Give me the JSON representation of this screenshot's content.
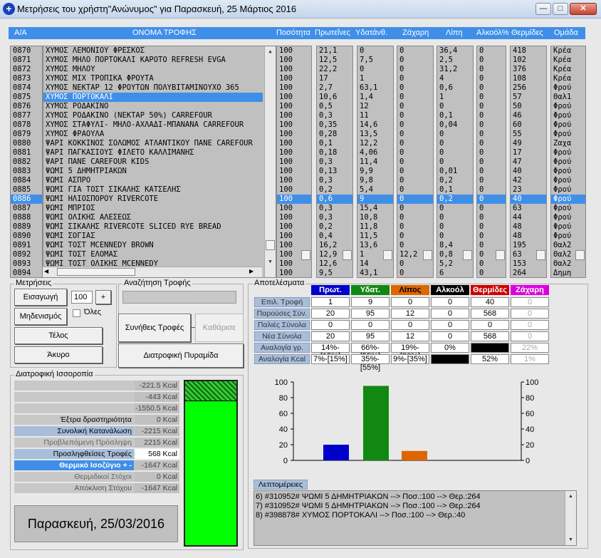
{
  "window": {
    "title": "Μετρήσεις του χρήστη\"Ανώνυμος\" για Παρασκευή, 25 Μάρτιος 2016",
    "minimize": "—",
    "maximize": "□",
    "close": "✕"
  },
  "colors": {
    "selection": "#3f8fe8",
    "protein": "#0000cc",
    "water": "#118811",
    "fat": "#dd6600",
    "alcohol": "#000000",
    "calories": "#cc0000",
    "sugar": "#dd00dd",
    "gauge": "#00ff00"
  },
  "headers": {
    "aa": "Α/Α",
    "name": "ΟΝΟΜΑ ΤΡΟΦΗΣ",
    "qty": "Ποσότητα",
    "protein": "Πρωτεΐνες",
    "water": "Υδατάνθ.",
    "sugar": "Ζάχαρη",
    "fat": "Λίπη",
    "alcohol": "Αλκοόλ%",
    "calories": "Θερμίδες",
    "group": "Ομάδα"
  },
  "rows": [
    {
      "aa": "0870",
      "name": "ΧΥΜΟΣ ΛΕΜΟΝΙΟΥ ΦΡΕΣΚΟΣ",
      "qty": "100",
      "protein": "21,1",
      "water": "0",
      "sugar": "0",
      "fat": "36,4",
      "alcohol": "0",
      "cal": "418",
      "group": "Κρέα"
    },
    {
      "aa": "0871",
      "name": "ΧΥΜΟΣ ΜΗΛΟ ΠΟΡΤΟΚΑΛΙ ΚΑΡΟΤΟ REFRESH EVGA",
      "qty": "100",
      "protein": "12,5",
      "water": "7,5",
      "sugar": "0",
      "fat": "2,5",
      "alcohol": "0",
      "cal": "102",
      "group": "Κρέα"
    },
    {
      "aa": "0872",
      "name": "ΧΥΜΟΣ ΜΗΛΟΥ",
      "qty": "100",
      "protein": "22,2",
      "water": "0",
      "sugar": "0",
      "fat": "31,2",
      "alcohol": "0",
      "cal": "376",
      "group": "Κρέα"
    },
    {
      "aa": "0873",
      "name": "ΧΥΜΟΣ ΜΙΧ ΤΡΟΠΙΚΑ ΦΡΟΥΤΑ",
      "qty": "100",
      "protein": "17",
      "water": "1",
      "sugar": "0",
      "fat": "4",
      "alcohol": "0",
      "cal": "108",
      "group": "Κρέα"
    },
    {
      "aa": "0874",
      "name": "ΧΥΜΟΣ ΝΕΚΤΑΡ 12 ΦΡΟΥΤΩΝ ΠΟΛΥΒΙΤΑΜΙΝΟΥΧΟ 365",
      "qty": "100",
      "protein": "2,7",
      "water": "63,1",
      "sugar": "0",
      "fat": "0,6",
      "alcohol": "0",
      "cal": "256",
      "group": "Φρού"
    },
    {
      "aa": "0875",
      "name": "ΧΥΜΟΣ ΠΟΡΤΟΚΑΛΙ",
      "qty": "100",
      "protein": "10,6",
      "water": "1,4",
      "sugar": "0",
      "fat": "1",
      "alcohol": "0",
      "cal": "57",
      "group": "Θαλ1",
      "nameSel": true
    },
    {
      "aa": "0876",
      "name": "ΧΥΜΟΣ ΡΟΔΑΚΙΝΟ",
      "qty": "100",
      "protein": "0,5",
      "water": "12",
      "sugar": "0",
      "fat": "0",
      "alcohol": "0",
      "cal": "50",
      "group": "Φρού"
    },
    {
      "aa": "0877",
      "name": "ΧΥΜΟΣ ΡΟΔΑΚΙΝΟ (ΝΕΚΤΑΡ 50%) CARREFOUR",
      "qty": "100",
      "protein": "0,3",
      "water": "11",
      "sugar": "0",
      "fat": "0,1",
      "alcohol": "0",
      "cal": "46",
      "group": "Φρού"
    },
    {
      "aa": "0878",
      "name": "ΧΥΜΟΣ ΣΤΑΦΥΛΙ- ΜΗΛΟ-ΑΧΛΑΔΙ-ΜΠΑΝΑΝΑ CARREFOUR",
      "qty": "100",
      "protein": "0,35",
      "water": "14,6",
      "sugar": "0",
      "fat": "0,04",
      "alcohol": "0",
      "cal": "60",
      "group": "Φρού"
    },
    {
      "aa": "0879",
      "name": "ΧΥΜΟΣ ΦΡΑΟΥΛΑ",
      "qty": "100",
      "protein": "0,28",
      "water": "13,5",
      "sugar": "0",
      "fat": "0",
      "alcohol": "0",
      "cal": "55",
      "group": "Φρού"
    },
    {
      "aa": "0880",
      "name": "ΨΑΡΙ ΚΟΚΚΙΝΟΣ ΣΟΛΩΜΟΣ ΑΤΛΑΝΤΙΚΟΥ ΠΑΝΕ CAREFOUR",
      "qty": "100",
      "protein": "0,1",
      "water": "12,2",
      "sugar": "0",
      "fat": "0",
      "alcohol": "0",
      "cal": "49",
      "group": "Ζαχα"
    },
    {
      "aa": "0881",
      "name": "ΨΑΡΙ ΠΑΓΚΑΣΙΟΥΣ ΦΙΛΕΤΟ ΚΑΛΛΙΜΑΝΗΣ",
      "qty": "100",
      "protein": "0,18",
      "water": "4,06",
      "sugar": "0",
      "fat": "0",
      "alcohol": "0",
      "cal": "17",
      "group": "Φρού"
    },
    {
      "aa": "0882",
      "name": "ΨΑΡΙ ΠΑΝΕ CAREFOUR KIDS",
      "qty": "100",
      "protein": "0,3",
      "water": "11,4",
      "sugar": "0",
      "fat": "0",
      "alcohol": "0",
      "cal": "47",
      "group": "Φρού"
    },
    {
      "aa": "0883",
      "name": "ΨΩΜΙ 5 ΔΗΜΗΤΡΙΑΚΩΝ",
      "qty": "100",
      "protein": "0,13",
      "water": "9,9",
      "sugar": "0",
      "fat": "0,01",
      "alcohol": "0",
      "cal": "40",
      "group": "Φρού"
    },
    {
      "aa": "0884",
      "name": "ΨΩΜΙ ΑΣΠΡΟ",
      "qty": "100",
      "protein": "0,3",
      "water": "9,8",
      "sugar": "0",
      "fat": "0,2",
      "alcohol": "0",
      "cal": "42",
      "group": "Φρού"
    },
    {
      "aa": "0885",
      "name": "ΨΩΜΙ ΓΙΑ ΤΟΣΤ ΣΙΚΑΛΗΣ ΚΑΤΣΕΛΗΣ",
      "qty": "100",
      "protein": "0,2",
      "water": "5,4",
      "sugar": "0",
      "fat": "0,1",
      "alcohol": "0",
      "cal": "23",
      "group": "Φρού"
    },
    {
      "aa": "0886",
      "name": "ΨΩΜΙ ΗΛΙΟΣΠΟΡΟΥ RIVERCOTE",
      "qty": "100",
      "protein": "0,6",
      "water": "9",
      "sugar": "0",
      "fat": "0,2",
      "alcohol": "0",
      "cal": "40",
      "group": "Φρού",
      "rowSel": true
    },
    {
      "aa": "0887",
      "name": "ΨΩΜΙ ΜΠΡΙΟΣ",
      "qty": "100",
      "protein": "0,3",
      "water": "15,4",
      "sugar": "0",
      "fat": "0",
      "alcohol": "0",
      "cal": "63",
      "group": "Φρού"
    },
    {
      "aa": "0888",
      "name": "ΨΩΜΙ ΟΛΙΚΗΣ ΑΛΕΣΕΩΣ",
      "qty": "100",
      "protein": "0,3",
      "water": "10,8",
      "sugar": "0",
      "fat": "0",
      "alcohol": "0",
      "cal": "44",
      "group": "Φρού"
    },
    {
      "aa": "0889",
      "name": "ΨΩΜΙ ΣΙΚΑΛΗΣ RIVERCOTE SLICED RYE BREAD",
      "qty": "100",
      "protein": "0,2",
      "water": "11,8",
      "sugar": "0",
      "fat": "0",
      "alcohol": "0",
      "cal": "48",
      "group": "Φρού"
    },
    {
      "aa": "0890",
      "name": "ΨΩΜΙ ΣΟΓΙΑΣ",
      "qty": "100",
      "protein": "0,4",
      "water": "11,5",
      "sugar": "0",
      "fat": "0",
      "alcohol": "0",
      "cal": "48",
      "group": "Φρού"
    },
    {
      "aa": "0891",
      "name": "ΨΩΜΙ ΤΟΣΤ MCENNEDY BROWN",
      "qty": "100",
      "protein": "16,2",
      "water": "13,6",
      "sugar": "0",
      "fat": "8,4",
      "alcohol": "0",
      "cal": "195",
      "group": "Θαλ2"
    },
    {
      "aa": "0892",
      "name": "ΨΩΜΙ ΤΟΣΤ ΕΛΟΜΑΣ",
      "qty": "100",
      "protein": "12,9",
      "water": "1",
      "sugar": "12,2",
      "fat": "0,8",
      "alcohol": "0",
      "cal": "63",
      "group": "Θαλ2"
    },
    {
      "aa": "0893",
      "name": "ΨΩΜΙ ΤΟΣΤ ΟΛΙΚΗΣ MCENNEDY",
      "qty": "100",
      "protein": "12,6",
      "water": "14",
      "sugar": "0",
      "fat": "5,2",
      "alcohol": "0",
      "cal": "153",
      "group": "Θαλ2"
    },
    {
      "aa": "0894",
      "name": "",
      "qty": "100",
      "protein": "9,5",
      "water": "43,1",
      "sugar": "0",
      "fat": "6",
      "alcohol": "0",
      "cal": "264",
      "group": "Δημη"
    }
  ],
  "measurements": {
    "title": "Μετρήσεις",
    "insert": "Εισαγωγή",
    "reset": "Μηδενισμός",
    "all": "Όλες",
    "qty": "100",
    "plus": "+",
    "end": "Τέλος",
    "cancel": "Άκυρο"
  },
  "search": {
    "title": "Αναζήτηση Τροφής",
    "value": "",
    "usual": "Συνήθεις Τροφές",
    "clear": "Καθάρισε",
    "pyramid": "Διατροφική Πυραμίδα"
  },
  "results": {
    "title": "Αποτελέσματα",
    "cols": [
      "Πρωτ.",
      "Υδατ.",
      "Λίπος",
      "Αλκοόλ",
      "Θερμίδες",
      "Ζάχαρη"
    ],
    "rows": [
      {
        "label": "Επιλ. Τροφή",
        "values": [
          "1",
          "9",
          "0",
          "0",
          "40",
          "0"
        ]
      },
      {
        "label": "Παρούσες Σύν.",
        "values": [
          "20",
          "95",
          "12",
          "0",
          "568",
          "0"
        ]
      },
      {
        "label": "Παλιές Σύνολα",
        "values": [
          "0",
          "0",
          "0",
          "0",
          "0",
          "0"
        ]
      },
      {
        "label": "Νέα Σύνολα",
        "values": [
          "20",
          "95",
          "12",
          "0",
          "568",
          "0"
        ]
      },
      {
        "label": "Αναλογία γρ.",
        "values": [
          "14%-[15%]",
          "66%-[55%]",
          "19%-[30%]",
          "0%",
          "",
          "22%"
        ]
      },
      {
        "label": "Αναλογία Kcal",
        "values": [
          "7%-[15%]",
          "35%-[55%]",
          "9%-[35%]",
          "",
          "52%",
          "1%"
        ]
      }
    ]
  },
  "balance": {
    "title": "Διατροφική Ισσοροπία",
    "rows": [
      {
        "label": "",
        "value": "-221.5 Kcal"
      },
      {
        "label": "",
        "value": "-443 Kcal"
      },
      {
        "label": "",
        "value": "-1550.5 Kcal"
      },
      {
        "label": "Έξτρα δραστηριότητα",
        "value": "0 Kcal"
      },
      {
        "label": "Συνολική Κατανάλωση",
        "value": "-2215 Kcal"
      },
      {
        "label": "Προβλεπόμενη Πρόσληψη",
        "value": "2215 Kcal"
      },
      {
        "label": "Προσληφθείσες Τροφές",
        "value": "568 Kcal"
      },
      {
        "label": "Θερμικό Ισοζύγιο + -",
        "value": "-1647 Kcal"
      },
      {
        "label": "Θερμιδικοί Στόχοι",
        "value": "0 Kcal"
      },
      {
        "label": "Απόκλιση Στόχου",
        "value": "-1647 Kcal"
      }
    ],
    "date": "Παρασκευή, 25/03/2016",
    "gauge_fill": 0.88
  },
  "chart_data": {
    "type": "bar",
    "categories": [
      "Πρωτ.",
      "Υδατ.",
      "Λίπος"
    ],
    "values": [
      20,
      95,
      12
    ],
    "ylim": [
      0,
      100
    ],
    "yticks": [
      "0",
      "20",
      "40",
      "60",
      "80",
      "100"
    ]
  },
  "details": {
    "title": "Λεπτομέρειες",
    "lines": [
      "6) #310952# ΨΩΜΙ 5 ΔΗΜΗΤΡΙΑΚΩΝ --> Ποσ.:100 --> Θερ.:264",
      "7) #310952# ΨΩΜΙ 5 ΔΗΜΗΤΡΙΑΚΩΝ --> Ποσ.:100 --> Θερ.:264",
      "8) #398878# ΧΥΜΟΣ ΠΟΡΤΟΚΑΛΙ --> Ποσ.:100 --> Θερ.:40"
    ]
  }
}
